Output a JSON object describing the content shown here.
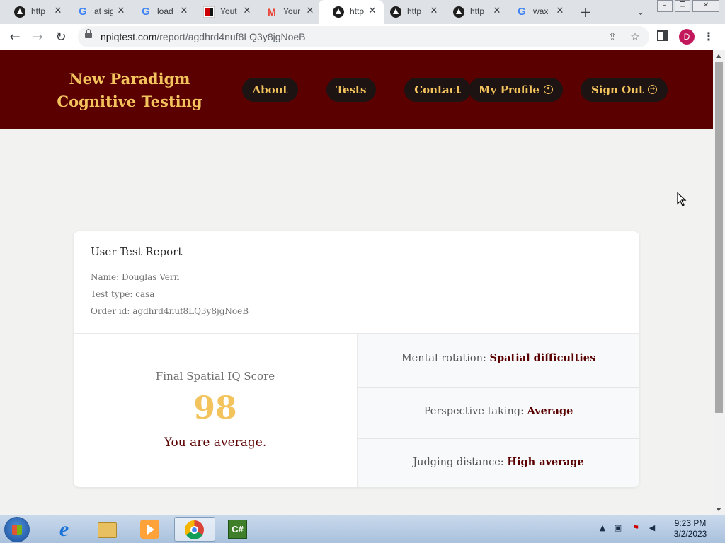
{
  "browser": {
    "tabs": [
      {
        "icon": "triangle-icon",
        "title": "http"
      },
      {
        "icon": "google-icon",
        "title": "at sig"
      },
      {
        "icon": "google-icon",
        "title": "load"
      },
      {
        "icon": "calendar-icon",
        "title": "Yout"
      },
      {
        "icon": "gmail-icon",
        "title": "Your"
      },
      {
        "icon": "triangle-icon",
        "title": "http",
        "active": true
      },
      {
        "icon": "triangle-icon",
        "title": "http"
      },
      {
        "icon": "triangle-icon",
        "title": "http"
      },
      {
        "icon": "google-icon",
        "title": "wax"
      }
    ],
    "url_host": "npiqtest.com",
    "url_path": "/report/agdhrd4nuf8LQ3y8jgNoeB",
    "profile_initial": "D"
  },
  "site": {
    "brand_line1": "New Paradigm",
    "brand_line2": "Cognitive Testing",
    "nav": {
      "about": "About",
      "tests": "Tests",
      "contact": "Contact",
      "profile": "My Profile",
      "signout": "Sign Out"
    },
    "colors": {
      "header_bg": "#5a0000",
      "accent": "#f3c35d"
    }
  },
  "report": {
    "title": "User Test Report",
    "name": "Name: Douglas Vern",
    "test_type": "Test type: casa",
    "order_id": "Order id: agdhrd4nuf8LQ3y8jgNoeB",
    "score_label": "Final Spatial IQ Score",
    "score": "98",
    "verdict": "You are average.",
    "subscores": [
      {
        "label": "Mental rotation:",
        "value": "Spatial difficulties"
      },
      {
        "label": "Perspective taking:",
        "value": "Average"
      },
      {
        "label": "Judging distance:",
        "value": "High average"
      }
    ]
  },
  "taskbar": {
    "clock_time": "9:23 PM",
    "clock_date": "3/2/2023",
    "cs_label": "C#"
  }
}
